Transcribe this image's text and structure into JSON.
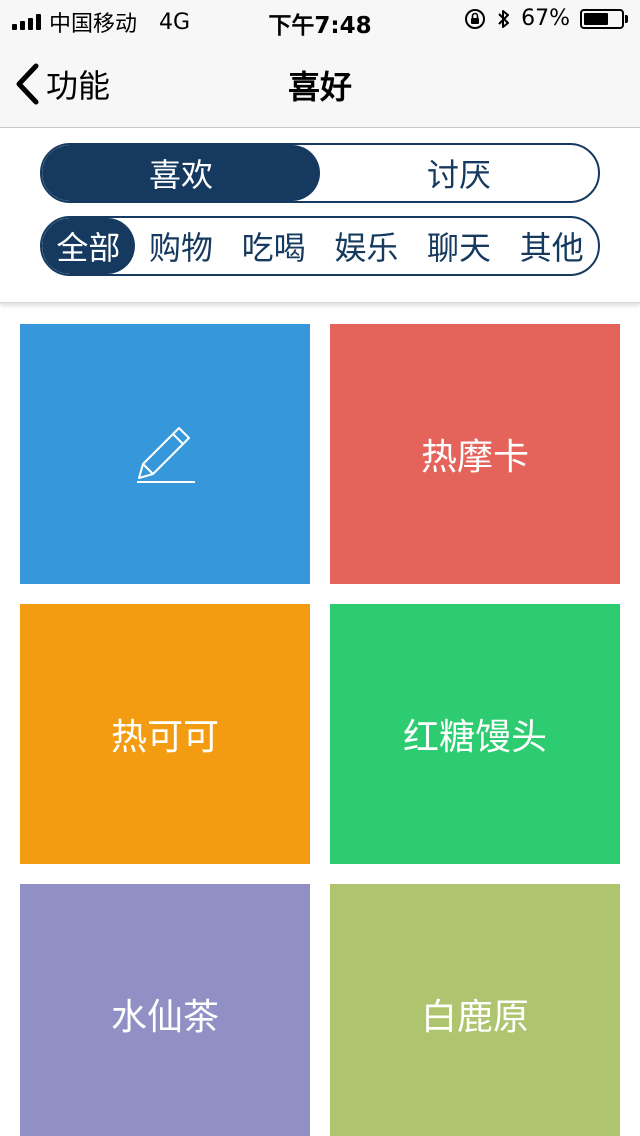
{
  "status_bar": {
    "carrier": "中国移动",
    "network": "4G",
    "time": "下午7:48",
    "battery_text": "67%",
    "battery_level": 0.67
  },
  "nav": {
    "back_label": "功能",
    "title": "喜好"
  },
  "segments": [
    {
      "label": "喜欢",
      "active": true
    },
    {
      "label": "讨厌",
      "active": false
    }
  ],
  "categories": [
    {
      "label": "全部",
      "active": true
    },
    {
      "label": "购物",
      "active": false
    },
    {
      "label": "吃喝",
      "active": false
    },
    {
      "label": "娱乐",
      "active": false
    },
    {
      "label": "聊天",
      "active": false
    },
    {
      "label": "其他",
      "active": false
    }
  ],
  "tiles": [
    {
      "label": "",
      "icon": "pencil-icon",
      "color": "#3698da"
    },
    {
      "label": "热摩卡",
      "color": "#e4645c"
    },
    {
      "label": "热可可",
      "color": "#f39c12"
    },
    {
      "label": "红糖馒头",
      "color": "#2ecc71"
    },
    {
      "label": "水仙茶",
      "color": "#9190c4"
    },
    {
      "label": "白鹿原",
      "color": "#aec46e"
    }
  ],
  "colors": {
    "accent": "#163a5f",
    "bar_bg": "#f7f7f7"
  }
}
